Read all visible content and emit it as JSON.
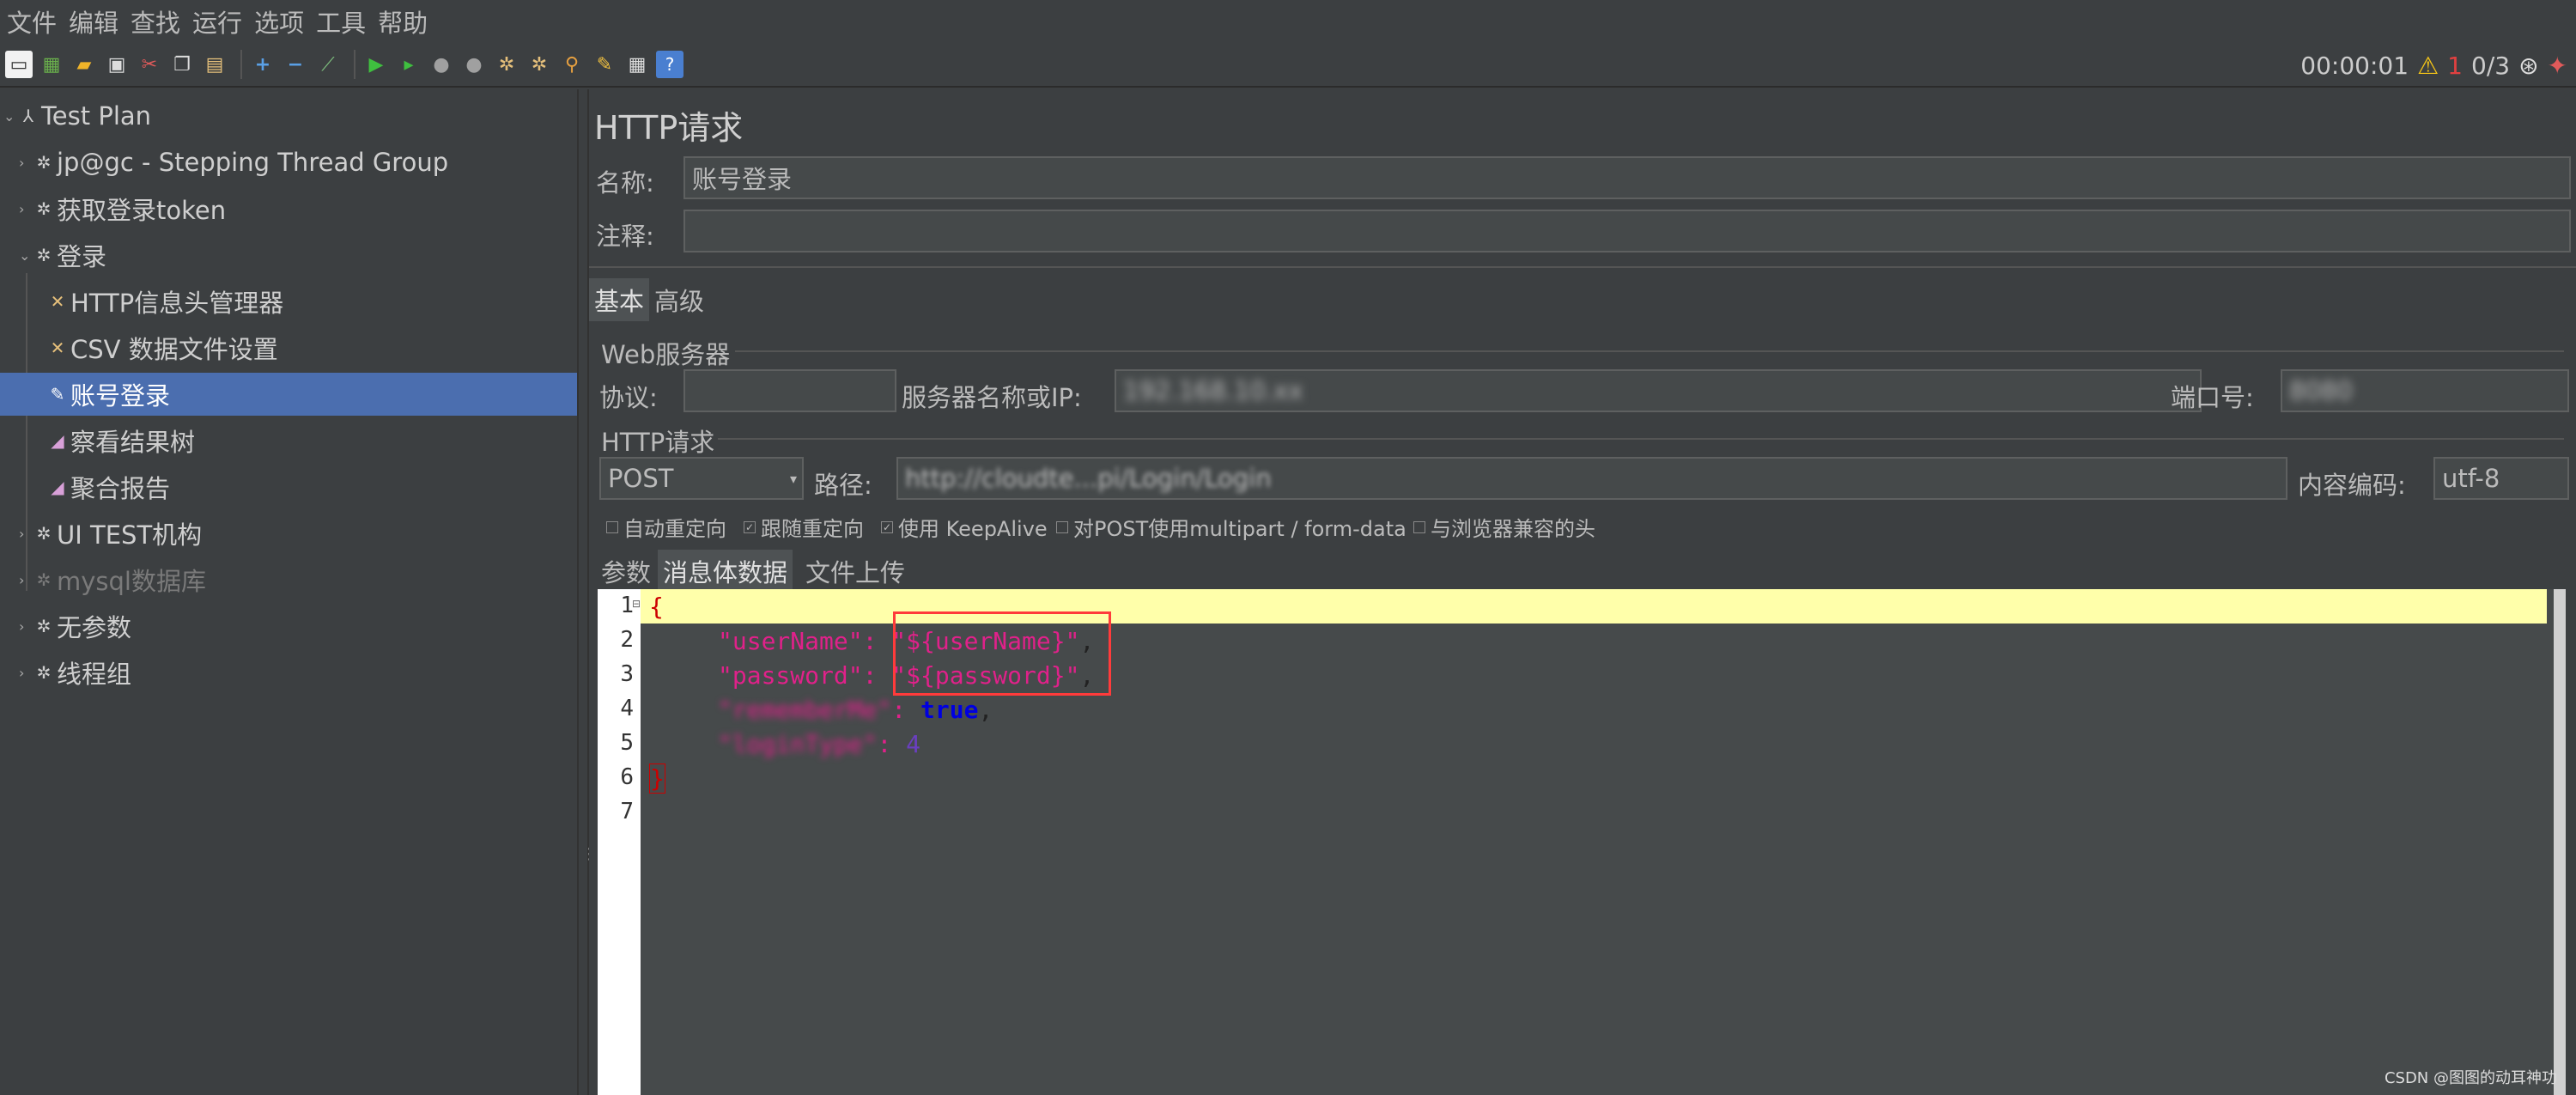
{
  "menu": [
    "文件",
    "编辑",
    "查找",
    "运行",
    "选项",
    "工具",
    "帮助"
  ],
  "toolbar": {
    "icons": [
      "new-icon",
      "templates-icon",
      "open-icon",
      "save-icon",
      "cut-icon",
      "copy-icon",
      "paste-icon",
      "expand-icon",
      "collapse-icon",
      "toggle-icon",
      "start-icon",
      "start-no-pause-icon",
      "stop-icon",
      "shutdown-icon",
      "clear-icon",
      "clear-all-icon",
      "search-icon",
      "reset-search-icon",
      "function-helper-icon",
      "help-icon"
    ],
    "timer": "00:00:01",
    "warning_count": "1",
    "threads": "0/3"
  },
  "tree": [
    {
      "label": "Test Plan",
      "level": 0,
      "icon": "test-plan-icon"
    },
    {
      "label": "jp@gc - Stepping Thread Group",
      "level": 1,
      "icon": "gear-icon"
    },
    {
      "label": "获取登录token",
      "level": 1,
      "icon": "gear-icon"
    },
    {
      "label": "登录",
      "level": 1,
      "icon": "gear-icon"
    },
    {
      "label": "HTTP信息头管理器",
      "level": 2,
      "icon": "wrench-icon"
    },
    {
      "label": "CSV 数据文件设置",
      "level": 2,
      "icon": "wrench-icon"
    },
    {
      "label": "账号登录",
      "level": 2,
      "icon": "pencil-icon",
      "selected": true
    },
    {
      "label": "察看结果树",
      "level": 2,
      "icon": "chart-icon"
    },
    {
      "label": "聚合报告",
      "level": 2,
      "icon": "chart-icon"
    },
    {
      "label": "UI TEST机构",
      "level": 1,
      "icon": "gear-icon"
    },
    {
      "label": "mysql数据库",
      "level": 1,
      "icon": "gear-icon",
      "disabled": true
    },
    {
      "label": "无参数",
      "level": 1,
      "icon": "gear-icon"
    },
    {
      "label": "线程组",
      "level": 1,
      "icon": "gear-icon"
    }
  ],
  "panel": {
    "title": "HTTP请求",
    "name_label": "名称:",
    "name_value": "账号登录",
    "comment_label": "注释:",
    "comment_value": "",
    "tabs": [
      "基本",
      "高级"
    ],
    "web_server_title": "Web服务器",
    "protocol_label": "协议:",
    "protocol_value": "",
    "server_label": "服务器名称或IP:",
    "server_value": "192.168.10.xx",
    "port_label": "端口号:",
    "port_value": "8080",
    "http_request_title": "HTTP请求",
    "method": "POST",
    "path_label": "路径:",
    "path_value": "http://cloudte...pi/Login/Login",
    "encoding_label": "内容编码:",
    "encoding_value": "utf-8",
    "options": [
      {
        "label": "自动重定向",
        "checked": false
      },
      {
        "label": "跟随重定向",
        "checked": true
      },
      {
        "label": "使用 KeepAlive",
        "checked": true
      },
      {
        "label": "对POST使用multipart / form-data",
        "checked": false
      },
      {
        "label": "与浏览器兼容的头",
        "checked": false
      }
    ],
    "body_tabs": [
      "参数",
      "消息体数据",
      "文件上传"
    ]
  },
  "editor": {
    "line_numbers": [
      "1",
      "2",
      "3",
      "4",
      "5",
      "6",
      "7"
    ],
    "lines": [
      {
        "open": "{"
      },
      {
        "key": "\"userName\"",
        "sep": ": ",
        "val": "\"${userName}\"",
        "end": ","
      },
      {
        "key": "\"password\"",
        "sep": ": ",
        "val": "\"${password}\"",
        "end": ","
      },
      {
        "key": "\"rememberMe\"",
        "sep": ": ",
        "bool": "true",
        "end": ","
      },
      {
        "key": "\"loginType\"",
        "sep": ": ",
        "num": "4"
      },
      {
        "close": "}"
      }
    ]
  },
  "watermark": "CSDN @图图的动耳神功",
  "colors": {
    "selected": "#4b6eaf",
    "current_line": "#ffffaa",
    "highlight_box": "#ff3b3b",
    "json_key": "#e0218a",
    "json_bool": "#0000e0"
  }
}
